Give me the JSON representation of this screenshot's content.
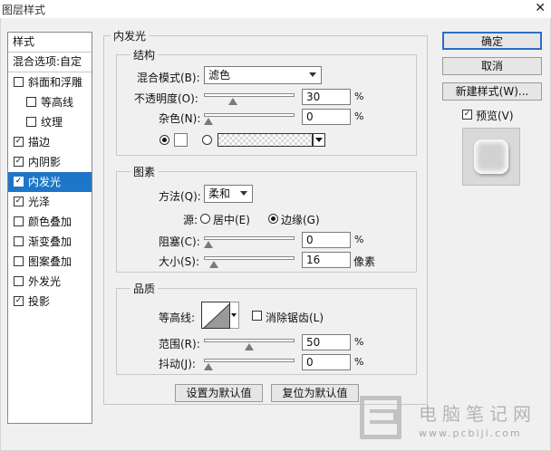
{
  "window": {
    "title": "图层样式",
    "close_glyph": "✕"
  },
  "styles_panel": {
    "header": "样式",
    "blend_options": "混合选项:自定",
    "items": [
      {
        "label": "斜面和浮雕",
        "checked": false,
        "indent": false
      },
      {
        "label": "等高线",
        "checked": false,
        "indent": true
      },
      {
        "label": "纹理",
        "checked": false,
        "indent": true
      },
      {
        "label": "描边",
        "checked": true,
        "indent": false
      },
      {
        "label": "内阴影",
        "checked": true,
        "indent": false
      },
      {
        "label": "内发光",
        "checked": true,
        "indent": false,
        "selected": true
      },
      {
        "label": "光泽",
        "checked": true,
        "indent": false
      },
      {
        "label": "颜色叠加",
        "checked": false,
        "indent": false
      },
      {
        "label": "渐变叠加",
        "checked": false,
        "indent": false
      },
      {
        "label": "图案叠加",
        "checked": false,
        "indent": false
      },
      {
        "label": "外发光",
        "checked": false,
        "indent": false
      },
      {
        "label": "投影",
        "checked": true,
        "indent": false
      }
    ]
  },
  "inner_glow": {
    "title": "内发光",
    "structure": {
      "title": "结构",
      "blend_mode_label": "混合模式(B):",
      "blend_mode_value": "滤色",
      "opacity_label": "不透明度(O):",
      "opacity_value": "30",
      "opacity_fraction": 0.3,
      "noise_label": "杂色(N):",
      "noise_value": "0",
      "noise_fraction": 0,
      "percent": "%"
    },
    "elements": {
      "title": "图素",
      "technique_label": "方法(Q):",
      "technique_value": "柔和",
      "source_label": "源:",
      "center_label": "居中(E)",
      "edge_label": "边缘(G)",
      "choke_label": "阻塞(C):",
      "choke_value": "0",
      "choke_fraction": 0,
      "size_label": "大小(S):",
      "size_value": "16",
      "size_fraction": 0.064,
      "percent": "%",
      "pixels": "像素"
    },
    "quality": {
      "title": "品质",
      "contour_label": "等高线:",
      "antialias_label": "消除锯齿(L)",
      "range_label": "范围(R):",
      "range_value": "50",
      "range_fraction": 0.5,
      "jitter_label": "抖动(J):",
      "jitter_value": "0",
      "jitter_fraction": 0,
      "percent": "%"
    },
    "set_default": "设置为默认值",
    "reset_default": "复位为默认值"
  },
  "buttons": {
    "ok": "确定",
    "cancel": "取消",
    "new_style": "新建样式(W)...",
    "preview": "预览(V)",
    "preview_checked": true
  },
  "watermark": {
    "cn": "电脑笔记网",
    "en": "www.pcbiji.com"
  },
  "colors": {
    "selection": "#1e76c8",
    "accent_border": "#2b6fc4"
  }
}
